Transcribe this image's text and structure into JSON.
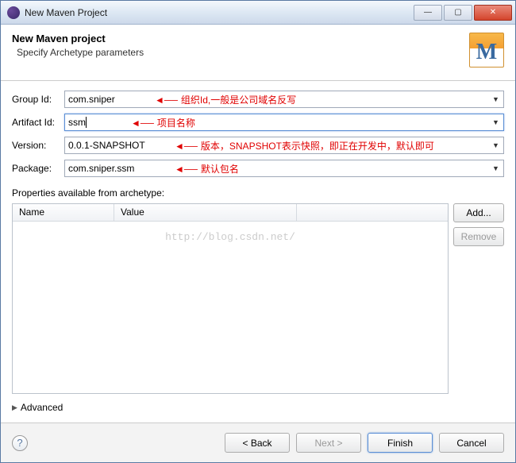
{
  "window": {
    "title": "New Maven Project"
  },
  "header": {
    "title": "New Maven project",
    "subtitle": "Specify Archetype parameters"
  },
  "form": {
    "group_id": {
      "label": "Group Id:",
      "value": "com.sniper",
      "note": "组织Id,一般是公司域名反写"
    },
    "artifact_id": {
      "label": "Artifact Id:",
      "value": "ssm",
      "note": "项目名称"
    },
    "version": {
      "label": "Version:",
      "value": "0.0.1-SNAPSHOT",
      "note": "版本，SNAPSHOT表示快照，即正在开发中，默认即可"
    },
    "package": {
      "label": "Package:",
      "value": "com.sniper.ssm",
      "note": "默认包名"
    }
  },
  "properties": {
    "label": "Properties available from archetype:",
    "columns": {
      "name": "Name",
      "value": "Value"
    },
    "add": "Add...",
    "remove": "Remove"
  },
  "advanced": "Advanced",
  "footer": {
    "back": "< Back",
    "next": "Next >",
    "finish": "Finish",
    "cancel": "Cancel"
  },
  "watermark": "http://blog.csdn.net/"
}
